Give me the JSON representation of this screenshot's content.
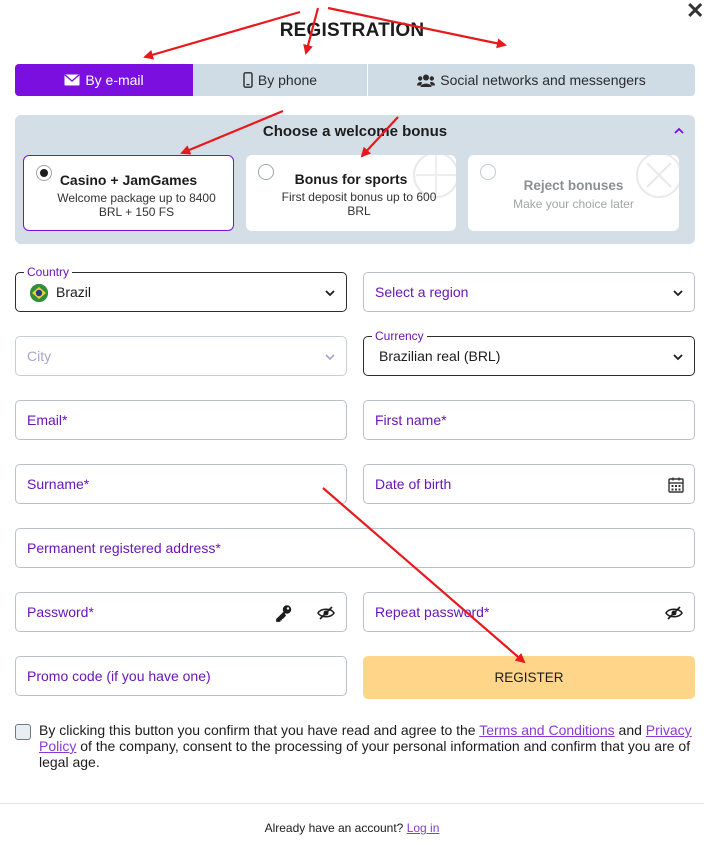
{
  "title": "REGISTRATION",
  "close_icon": "close-icon",
  "tabs": [
    {
      "label": "By e-mail",
      "icon": "envelope-icon",
      "active": true
    },
    {
      "label": "By phone",
      "icon": "phone-icon",
      "active": false
    },
    {
      "label": "Social networks and messengers",
      "icon": "users-icon",
      "active": false
    }
  ],
  "bonus": {
    "title": "Choose a welcome bonus",
    "cards": [
      {
        "name": "Casino + JamGames",
        "desc": "Welcome package up to 8400 BRL + 150 FS",
        "selected": true
      },
      {
        "name": "Bonus for sports",
        "desc": "First deposit bonus up to 600 BRL",
        "selected": false
      },
      {
        "name": "Reject bonuses",
        "desc": "Make your choice later",
        "selected": false
      }
    ]
  },
  "form": {
    "country_label": "Country",
    "country_value": "Brazil",
    "region_placeholder": "Select a region",
    "city_placeholder": "City",
    "currency_label": "Currency",
    "currency_value": "Brazilian real (BRL)",
    "email_placeholder": "Email*",
    "first_name_placeholder": "First name*",
    "surname_placeholder": "Surname*",
    "dob_placeholder": "Date of birth",
    "address_placeholder": "Permanent registered address*",
    "password_placeholder": "Password*",
    "repeat_password_placeholder": "Repeat password*",
    "promo_placeholder": "Promo code (if you have one)",
    "register_label": "REGISTER"
  },
  "consent": {
    "text_before": "By clicking this button you confirm that you have read and agree to the ",
    "terms_link": "Terms and Conditions",
    "and": " and ",
    "privacy_link": "Privacy Policy",
    "text_after": " of the company, consent to the processing of your personal information and confirm that you are of legal age."
  },
  "footer": {
    "text": "Already have an account?",
    "login_link": "Log in"
  },
  "colors": {
    "accent": "#7a0fe0",
    "register_bg": "#ffd58a",
    "panel_bg": "#d4dee7",
    "annotation_arrow": "#e8191c"
  }
}
